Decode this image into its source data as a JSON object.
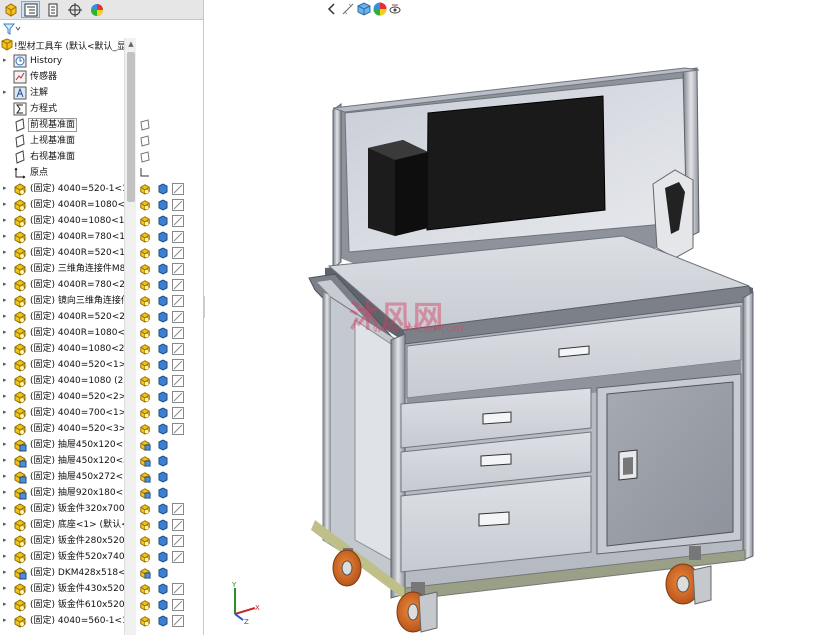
{
  "feature_tree": {
    "root": {
      "label": "!型材工具车  (默认<默认_显",
      "icon": "assembly-icon"
    },
    "items": [
      {
        "label": "History",
        "icon": "history-icon",
        "expandable": true
      },
      {
        "label": "传感器",
        "icon": "sensor-icon",
        "expandable": false
      },
      {
        "label": "注解",
        "icon": "annotation-icon",
        "expandable": true
      },
      {
        "label": "方程式",
        "icon": "equation-icon",
        "expandable": false
      },
      {
        "label": "前视基准面",
        "icon": "plane-icon",
        "expandable": false,
        "selected": true
      },
      {
        "label": "上视基准面",
        "icon": "plane-icon",
        "expandable": false
      },
      {
        "label": "右视基准面",
        "icon": "plane-icon",
        "expandable": false
      },
      {
        "label": "原点",
        "icon": "origin-icon",
        "expandable": false
      },
      {
        "label": "(固定) 4040=520-1<1>",
        "icon": "part-icon",
        "expandable": true
      },
      {
        "label": "(固定) 4040R=1080<1>",
        "icon": "part-icon",
        "expandable": true
      },
      {
        "label": "(固定) 4040=1080<1>",
        "icon": "part-icon",
        "expandable": true
      },
      {
        "label": "(固定) 4040R=780<1>",
        "icon": "part-icon",
        "expandable": true
      },
      {
        "label": "(固定) 4040R=520<1>",
        "icon": "part-icon",
        "expandable": true
      },
      {
        "label": "(固定) 三维角连接件M8",
        "icon": "part-icon",
        "expandable": true
      },
      {
        "label": "(固定) 4040R=780<2>",
        "icon": "part-icon",
        "expandable": true
      },
      {
        "label": "(固定) 镜向三维角连接件",
        "icon": "part-icon",
        "expandable": true
      },
      {
        "label": "(固定) 4040R=520<2>",
        "icon": "part-icon",
        "expandable": true
      },
      {
        "label": "(固定) 4040R=1080<2>",
        "icon": "part-icon",
        "expandable": true
      },
      {
        "label": "(固定) 4040=1080<2>",
        "icon": "part-icon",
        "expandable": true
      },
      {
        "label": "(固定) 4040=520<1> (",
        "icon": "part-icon",
        "expandable": true
      },
      {
        "label": "(固定) 4040=1080 (2)<",
        "icon": "part-icon",
        "expandable": true
      },
      {
        "label": "(固定) 4040=520<2> (",
        "icon": "part-icon",
        "expandable": true
      },
      {
        "label": "(固定) 4040=700<1> (",
        "icon": "part-icon",
        "expandable": true
      },
      {
        "label": "(固定) 4040=520<3> (",
        "icon": "part-icon",
        "expandable": true
      },
      {
        "label": "(固定) 抽屉450x120<1:",
        "icon": "subassembly-icon",
        "expandable": true
      },
      {
        "label": "(固定) 抽屉450x120<2:",
        "icon": "subassembly-icon",
        "expandable": true
      },
      {
        "label": "(固定) 抽屉450x272<1:",
        "icon": "subassembly-icon",
        "expandable": true
      },
      {
        "label": "(固定) 抽屉920x180<1:",
        "icon": "subassembly-icon",
        "expandable": true
      },
      {
        "label": "(固定) 钣金件320x700x",
        "icon": "part-icon",
        "expandable": true
      },
      {
        "label": "(固定) 底座<1> (默认<",
        "icon": "part-icon",
        "expandable": true
      },
      {
        "label": "(固定) 钣金件280x520x",
        "icon": "part-icon",
        "expandable": true
      },
      {
        "label": "(固定) 钣金件520x740x",
        "icon": "part-icon",
        "expandable": true
      },
      {
        "label": "(固定) DKM428x518<1",
        "icon": "subassembly-icon",
        "expandable": true
      },
      {
        "label": "(固定) 钣金件430x520x",
        "icon": "part-icon",
        "expandable": true
      },
      {
        "label": "(固定) 钣金件610x520x",
        "icon": "part-icon",
        "expandable": true
      },
      {
        "label": "(固定) 4040=560-1<1>",
        "icon": "part-icon",
        "expandable": true
      }
    ]
  },
  "watermark": {
    "text": "沐风网",
    "url": "www.mfcad.com"
  },
  "triad": {
    "x": "X",
    "y": "Y",
    "z": "Z"
  }
}
